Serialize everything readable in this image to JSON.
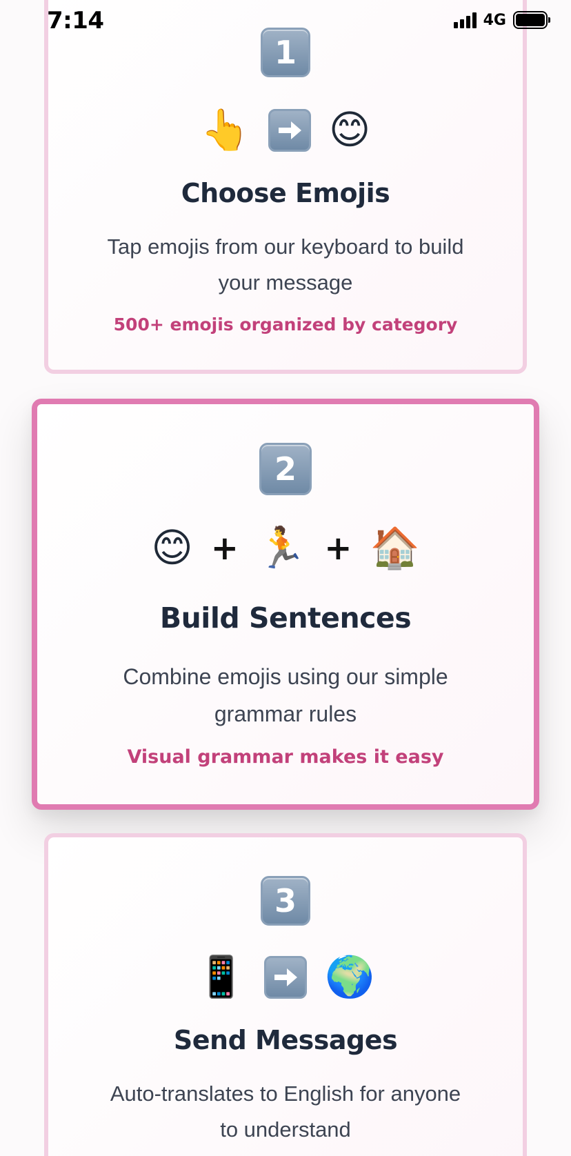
{
  "status_bar": {
    "time": "7:14",
    "network": "4G"
  },
  "steps": [
    {
      "number": "1",
      "emojis": [
        "👆",
        "arrow-right",
        "😊"
      ],
      "title": "Choose Emojis",
      "description_line1": "Tap emojis from our keyboard to build",
      "description_line2": "your message",
      "note": "500+ emojis organized by category"
    },
    {
      "number": "2",
      "emojis": [
        "😊",
        "+",
        "🏃",
        "+",
        "🏠"
      ],
      "title": "Build Sentences",
      "description_line1": "Combine emojis using our simple",
      "description_line2": "grammar rules",
      "note": "Visual grammar makes it easy"
    },
    {
      "number": "3",
      "emojis": [
        "📱",
        "arrow-right",
        "🌍"
      ],
      "title": "Send Messages",
      "description_line1": "Auto-translates to English for anyone",
      "description_line2": "to understand"
    }
  ],
  "colors": {
    "accent": "#c2417a",
    "active_border": "#e07bb1",
    "inactive_border": "#f2cfe2"
  }
}
